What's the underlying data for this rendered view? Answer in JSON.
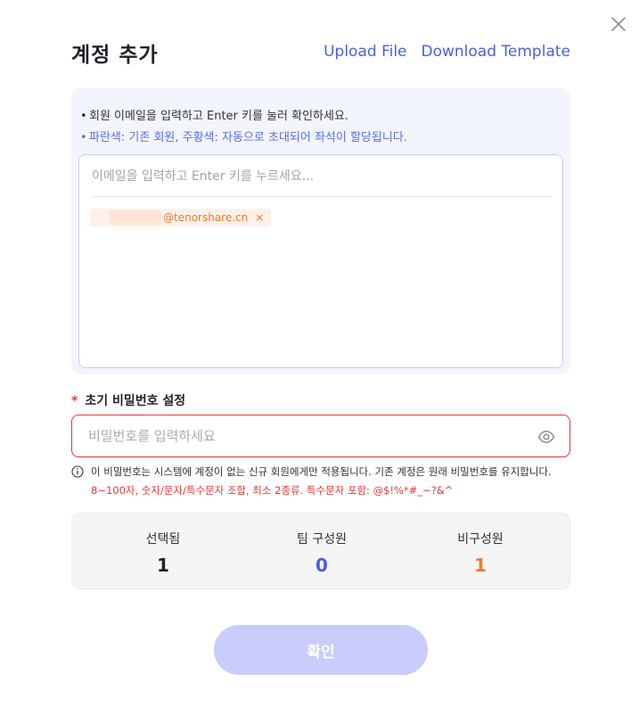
{
  "modal": {
    "title": "계정 추가",
    "upload_link": "Upload File",
    "download_link": "Download Template"
  },
  "hints": {
    "line1": "회원 이메일을 입력하고 Enter 키를 눌러 확인하세요.",
    "line2": "파란색: 기존 회원, 주황색: 자동으로 초대되어 좌석이 할당됩니다."
  },
  "email": {
    "placeholder": "이메일을 입력하고 Enter 키를 누르세요...",
    "tags": [
      {
        "text": "@tenorshare.cn",
        "remove": "×"
      }
    ]
  },
  "password": {
    "required_mark": "*",
    "label": "초기 비밀번호 설정",
    "placeholder": "비밀번호를 입력하세요",
    "note": "이 비밀번호는 시스템에 계정이 없는 신규 회원에게만 적용됩니다. 기존 계정은 원래 비밀번호를 유지합니다.",
    "rule": "8~100자, 숫자/문자/특수문자 조합, 최소 2종류. 특수문자 포함: @$!%*#_~?&^"
  },
  "stats": [
    {
      "label": "선택됨",
      "value": "1",
      "color": "#1f2329"
    },
    {
      "label": "팀 구성원",
      "value": "0",
      "color": "#4a5fe0"
    },
    {
      "label": "비구성원",
      "value": "1",
      "color": "#f07a2a"
    }
  ],
  "actions": {
    "confirm": "확인"
  },
  "icons": {
    "close": "close-icon",
    "eye": "eye-icon",
    "info": "info-icon",
    "tag_remove": "x-icon"
  },
  "colors": {
    "accent": "#4a5fe0",
    "orange": "#f07a2a",
    "error": "#e0383b",
    "button_disabled": "#c8cdfc"
  }
}
